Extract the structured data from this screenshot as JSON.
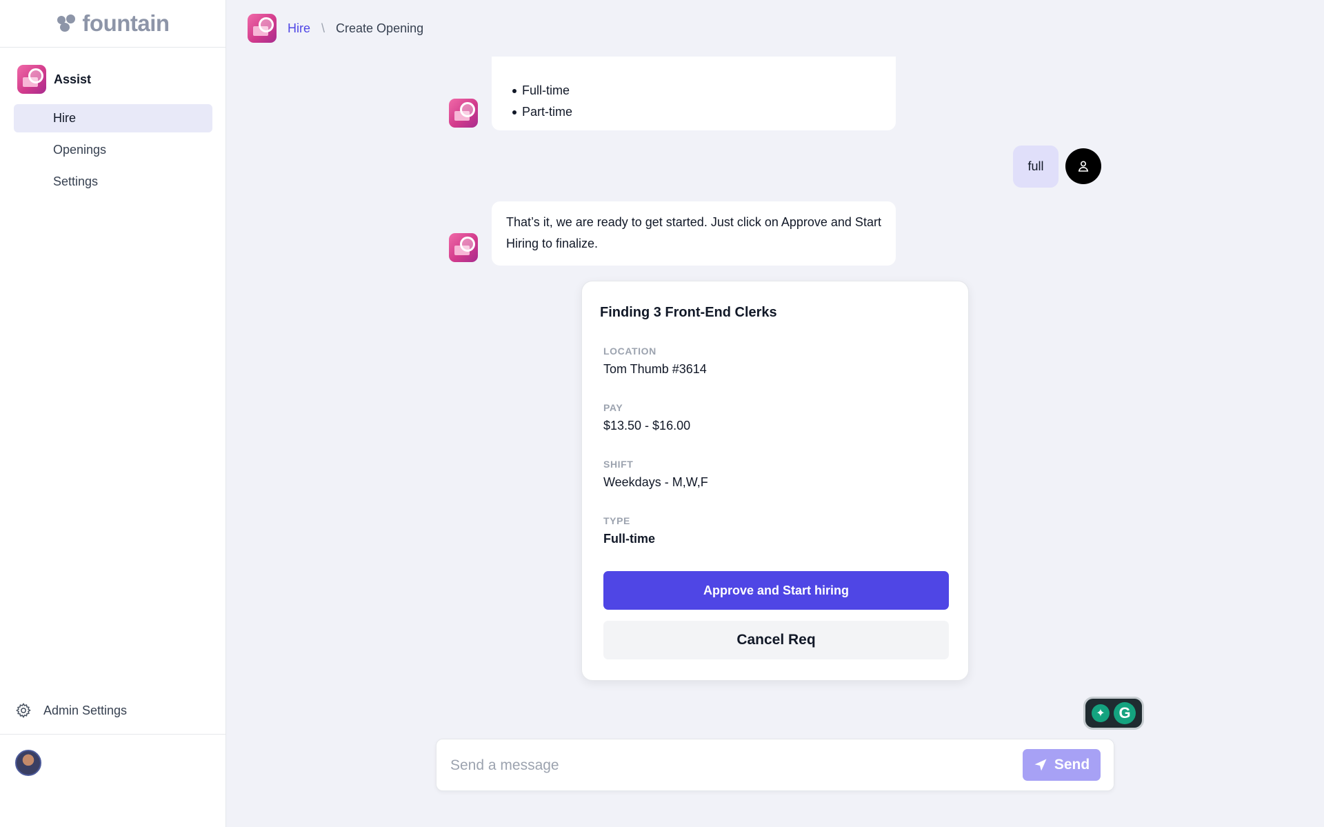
{
  "brand": {
    "name": "fountain"
  },
  "sidebar": {
    "assist_label": "Assist",
    "items": [
      {
        "label": "Hire",
        "active": true
      },
      {
        "label": "Openings",
        "active": false
      },
      {
        "label": "Settings",
        "active": false
      }
    ],
    "admin_label": "Admin Settings"
  },
  "breadcrumb": {
    "link": "Hire",
    "separator": "\\",
    "current": "Create Opening"
  },
  "chat": {
    "bot_options": [
      "Full-time",
      "Part-time"
    ],
    "user_reply": "full",
    "bot_final": "That’s it, we are ready to get started. Just click on Approve and Start Hiring to finalize."
  },
  "card": {
    "title": "Finding 3 Front-End Clerks",
    "fields": [
      {
        "label": "LOCATION",
        "value": "Tom Thumb #3614"
      },
      {
        "label": "PAY",
        "value": "$13.50 - $16.00"
      },
      {
        "label": "SHIFT",
        "value": "Weekdays - M,W,F"
      },
      {
        "label": "TYPE",
        "value": "Full-time"
      }
    ],
    "approve_label": "Approve and Start hiring",
    "cancel_label": "Cancel Req"
  },
  "composer": {
    "placeholder": "Send a message",
    "send_label": "Send"
  },
  "colors": {
    "accent": "#4f46e5",
    "send_disabled": "#a7a1f5",
    "active_nav": "#e8e9f8",
    "user_bubble": "#e0dffa"
  }
}
